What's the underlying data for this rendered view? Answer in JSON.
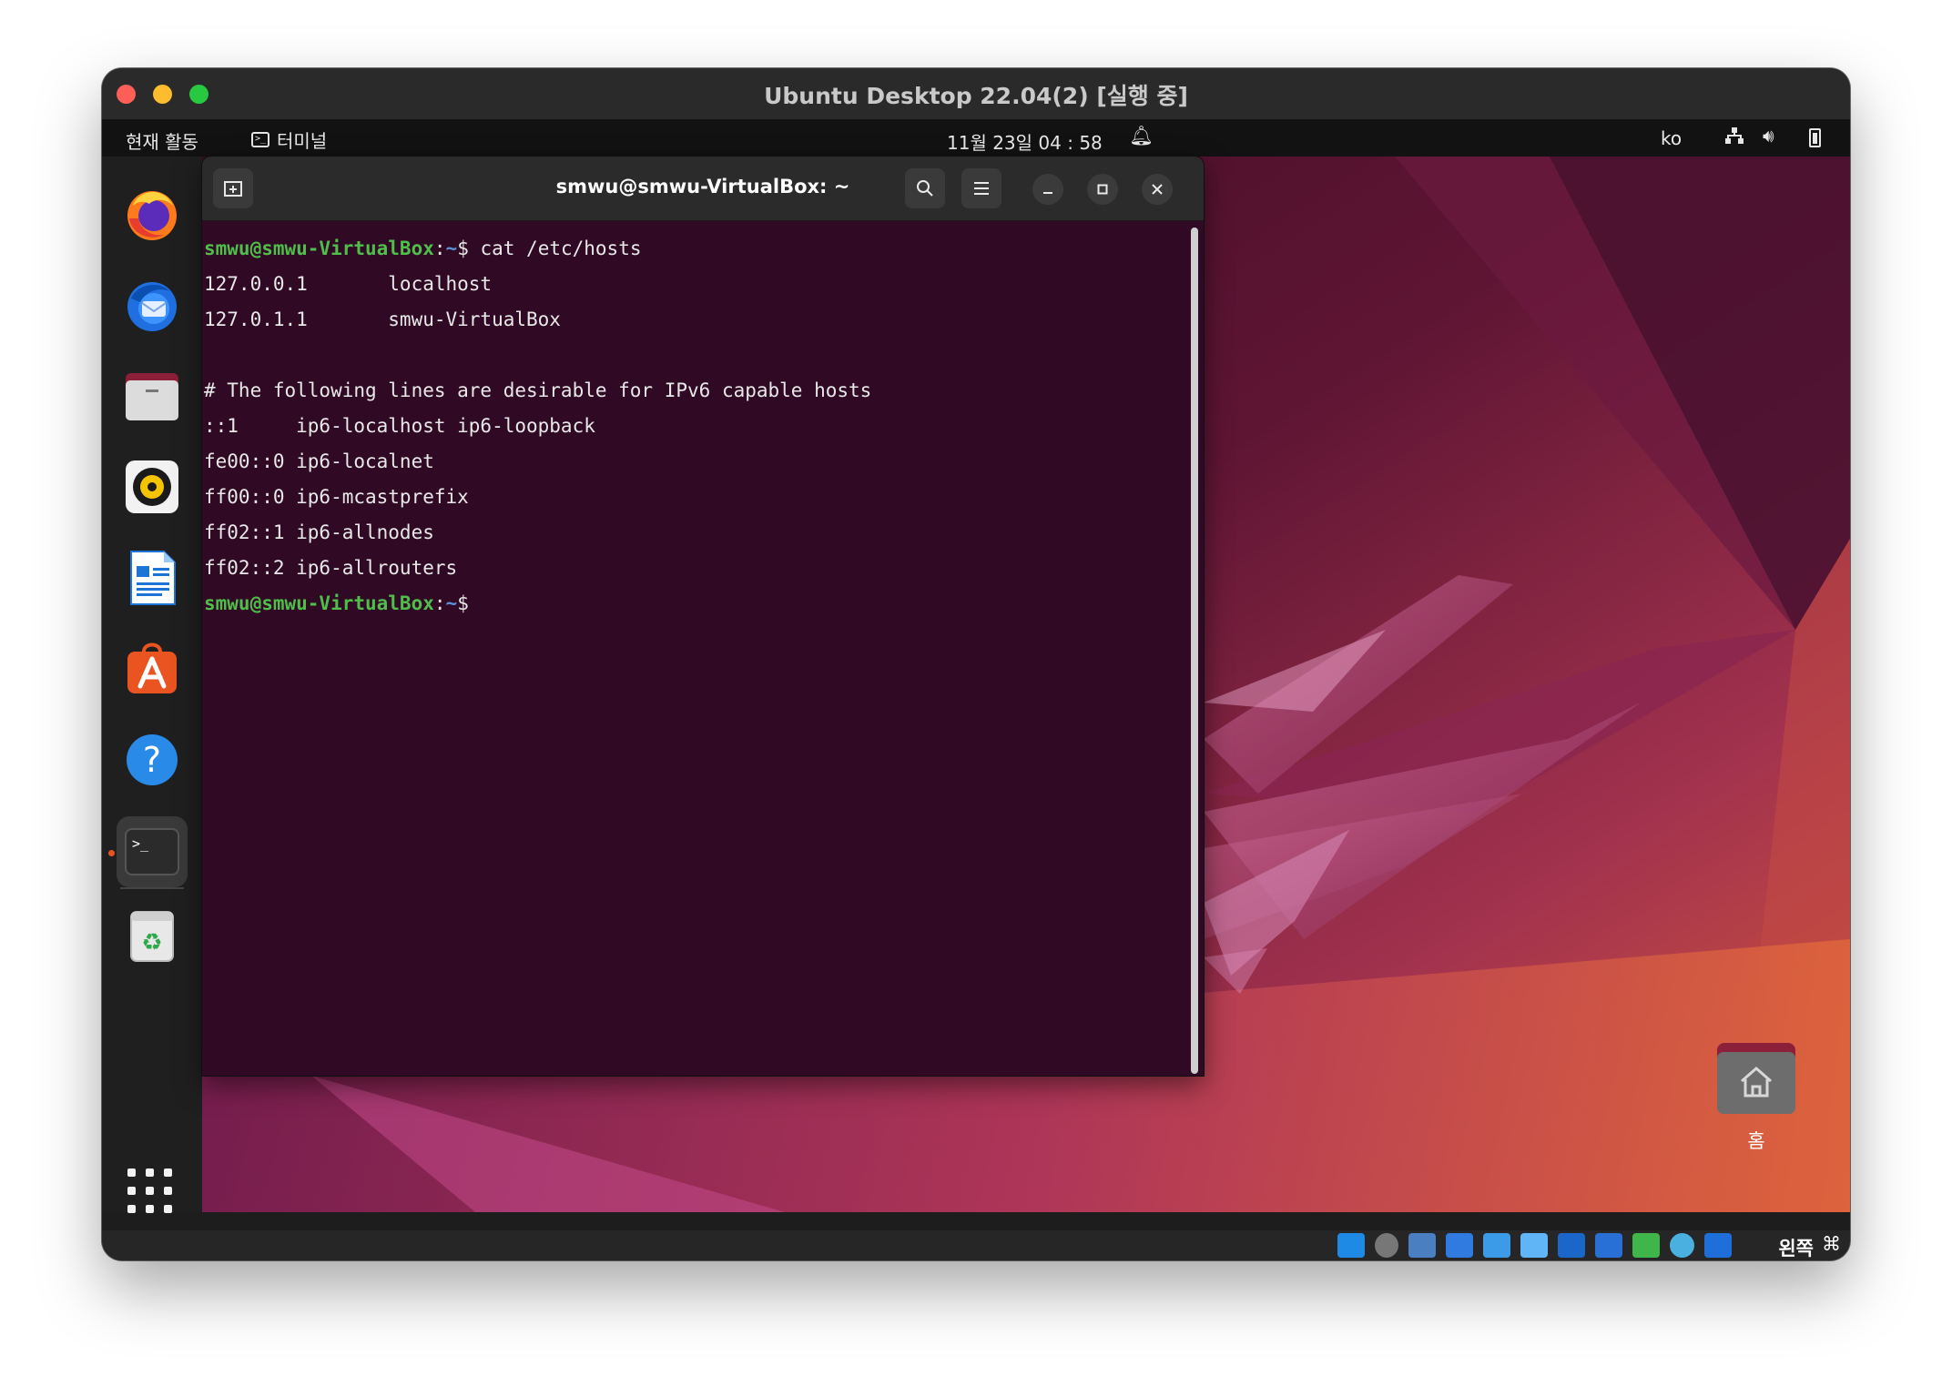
{
  "vbox": {
    "title": "Ubuntu Desktop 22.04(2) [실행 중]",
    "host_key_label": "왼쪽",
    "host_key_symbol": "⌘"
  },
  "topbar": {
    "activities": "현재 활동",
    "app_name": "터미널",
    "clock": "11월 23일  04 : 58",
    "input_lang": "ko"
  },
  "dock": {
    "items": [
      "firefox",
      "thunderbird",
      "files",
      "rhythmbox",
      "libreoffice-writer",
      "ubuntu-software",
      "help",
      "terminal",
      "trash"
    ]
  },
  "terminal": {
    "title": "smwu@smwu-VirtualBox: ~",
    "prompt_user": "smwu@smwu-VirtualBox",
    "prompt_sep": ":",
    "prompt_path": "~",
    "prompt_symbol": "$",
    "command": " cat /etc/hosts",
    "output": [
      "127.0.0.1       localhost",
      "127.0.1.1       smwu-VirtualBox",
      "",
      "# The following lines are desirable for IPv6 capable hosts",
      "::1     ip6-localhost ip6-loopback",
      "fe00::0 ip6-localnet",
      "ff00::0 ip6-mcastprefix",
      "ff02::1 ip6-allnodes",
      "ff02::2 ip6-allrouters"
    ]
  },
  "desktop": {
    "home_label": "홈"
  },
  "colors": {
    "terminal_bg": "#300a24",
    "prompt_user": "#4fbe4a",
    "prompt_path": "#5b8fd6",
    "accent": "#e95420"
  }
}
